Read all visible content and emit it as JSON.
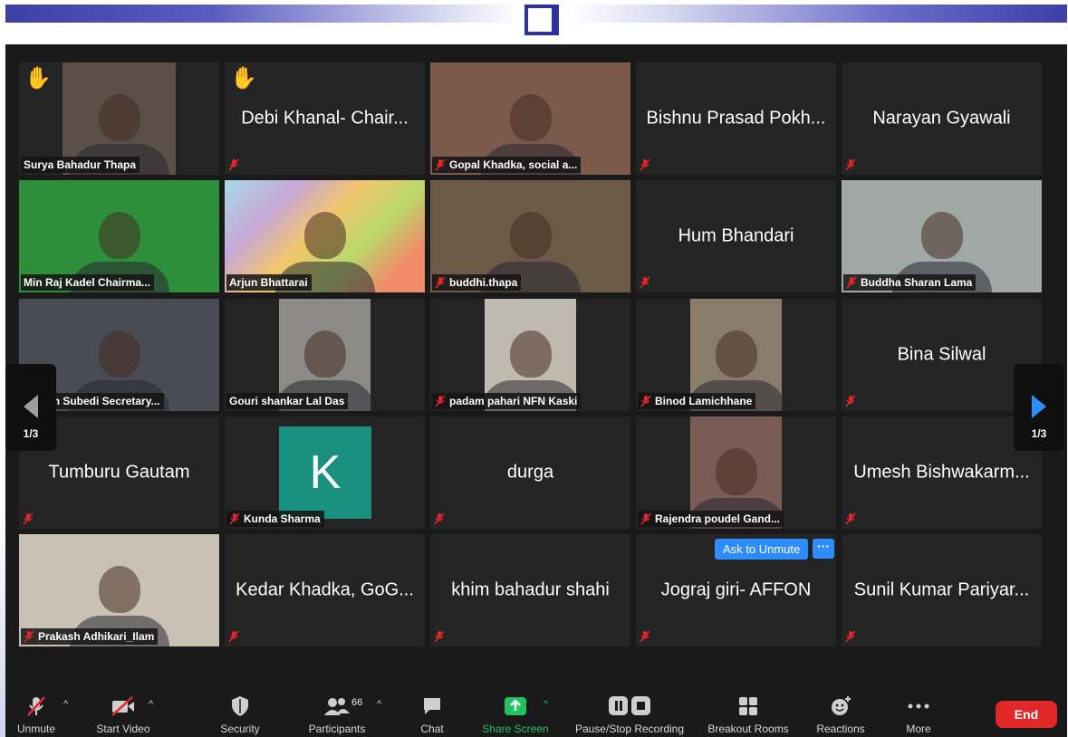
{
  "tiles": [
    {
      "name": "Surya Bahadur Thapa",
      "hand": true,
      "video": true,
      "bg": "#5a5048",
      "name_tag": true
    },
    {
      "name": "Debi Khanal- Chair...",
      "hand": true,
      "video": false
    },
    {
      "name": "Gopal Khadka, social a...",
      "video": true,
      "bg": "#7b5a4c",
      "name_tag": true,
      "muted": true
    },
    {
      "name": "Bishnu Prasad Pokh...",
      "video": false
    },
    {
      "name": "Narayan Gyawali",
      "video": false
    },
    {
      "name": "Min Raj Kadel Chairma...",
      "video": true,
      "bg": "#2e8f3b",
      "name_tag": true,
      "speaking": true
    },
    {
      "name": "Arjun Bhattarai",
      "video": true,
      "bg": "#9dc3d6",
      "name_tag": true,
      "map": true
    },
    {
      "name": "buddhi.thapa",
      "video": true,
      "bg": "#6b5a46",
      "name_tag": true,
      "muted": true
    },
    {
      "name": "Hum Bhandari",
      "video": false
    },
    {
      "name": "Buddha Sharan Lama",
      "video": true,
      "bg": "#a0a8a6",
      "name_tag": true,
      "muted": true
    },
    {
      "name": "..am Subedi Secretary...",
      "video": true,
      "bg": "#4a4c55",
      "name_tag": true,
      "muted": true
    },
    {
      "name": "Gouri shankar Lal Das",
      "video": true,
      "bg": "#8b8a86",
      "name_tag": true,
      "narrow": true
    },
    {
      "name": "padam pahari NFN Kaski",
      "video": true,
      "bg": "#c0b9ad",
      "name_tag": true,
      "narrow": true,
      "muted": true
    },
    {
      "name": "Binod Lamichhane",
      "video": true,
      "bg": "#8a7c6a",
      "name_tag": true,
      "narrow": true,
      "muted": true
    },
    {
      "name": "Bina Silwal",
      "video": false
    },
    {
      "name": "Tumburu Gautam",
      "video": false
    },
    {
      "name": "Kunda Sharma",
      "video": false,
      "avatar": "K",
      "name_tag": true,
      "muted": true
    },
    {
      "name": "durga",
      "video": false
    },
    {
      "name": "Rajendra poudel Gand...",
      "video": true,
      "bg": "#7a5c56",
      "name_tag": true,
      "narrow": true,
      "muted": true
    },
    {
      "name": "Umesh Bishwakarm...",
      "video": false
    },
    {
      "name": "Prakash Adhikari_Ilam",
      "video": true,
      "bg": "#c9c2b4",
      "name_tag": true,
      "muted": true
    },
    {
      "name": "Kedar Khadka, GoG...",
      "video": false
    },
    {
      "name": "khim bahadur shahi",
      "video": false
    },
    {
      "name": "Jograj giri- AFFON",
      "video": false,
      "ask_unmute": true
    },
    {
      "name": "Sunil Kumar Pariyar...",
      "video": false
    }
  ],
  "ask_unmute_label": "Ask to Unmute",
  "ask_more_label": "···",
  "page_indicator": "1/3",
  "toolbar": {
    "unmute": "Unmute",
    "start_video": "Start Video",
    "security": "Security",
    "participants": "Participants",
    "participants_count": "66",
    "chat": "Chat",
    "share_screen": "Share Screen",
    "recording": "Pause/Stop Recording",
    "breakout": "Breakout Rooms",
    "reactions": "Reactions",
    "more": "More",
    "end": "End"
  },
  "colors": {
    "accent_blue": "#2d8cff",
    "share_green": "#22c35e",
    "end_red": "#e02828",
    "speaking_outline": "#c6dd3b",
    "mute_red": "#e5262a"
  },
  "icons": [
    "raised-hand-icon",
    "muted-mic-icon",
    "chevron-left-icon",
    "chevron-right-icon",
    "mic-off-icon",
    "video-off-icon",
    "shield-icon",
    "participants-icon",
    "chat-icon",
    "share-screen-icon",
    "pause-stop-icon",
    "breakout-rooms-icon",
    "reactions-icon",
    "more-dots-icon"
  ]
}
